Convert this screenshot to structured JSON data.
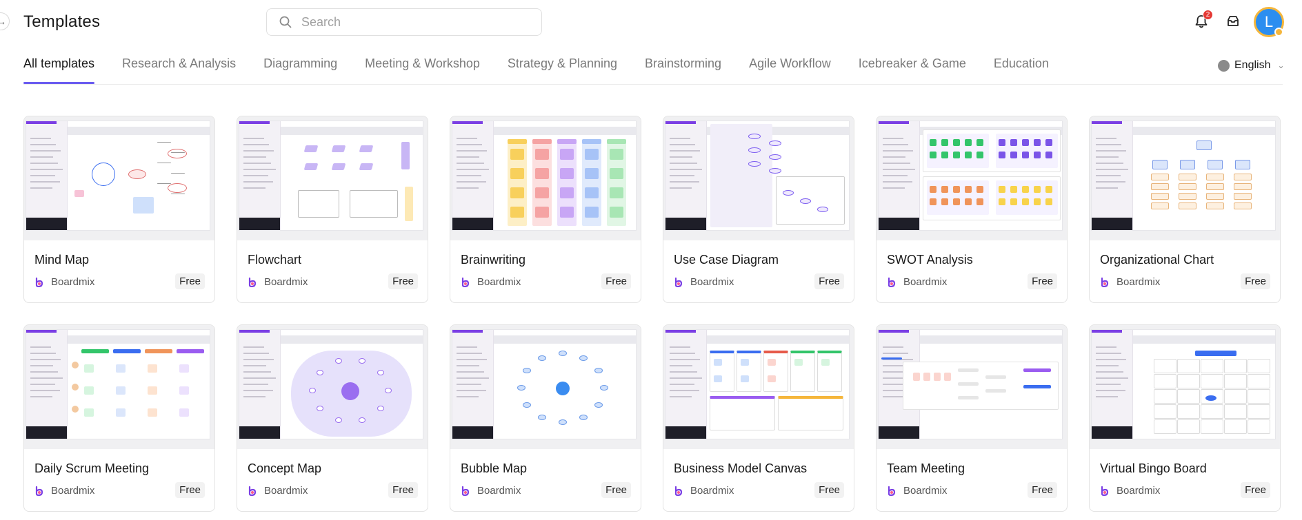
{
  "header": {
    "title": "Templates",
    "search_placeholder": "Search",
    "notification_count": "2",
    "avatar_initial": "L"
  },
  "tabs": [
    {
      "label": "All templates",
      "active": true
    },
    {
      "label": "Research & Analysis"
    },
    {
      "label": "Diagramming"
    },
    {
      "label": "Meeting & Workshop"
    },
    {
      "label": "Strategy & Planning"
    },
    {
      "label": "Brainstorming"
    },
    {
      "label": "Agile Workflow"
    },
    {
      "label": "Icebreaker & Game"
    },
    {
      "label": "Education"
    }
  ],
  "language": "English",
  "colors": {
    "accent": "#6b5cf0",
    "badge": "#e53935",
    "avatar": "#2c8ef0",
    "avatar_ring": "#f5b63b"
  },
  "templates": [
    {
      "name": "Mind Map",
      "brand": "Boardmix",
      "price": "Free"
    },
    {
      "name": "Flowchart",
      "brand": "Boardmix",
      "price": "Free"
    },
    {
      "name": "Brainwriting",
      "brand": "Boardmix",
      "price": "Free"
    },
    {
      "name": "Use Case Diagram",
      "brand": "Boardmix",
      "price": "Free"
    },
    {
      "name": "SWOT Analysis",
      "brand": "Boardmix",
      "price": "Free"
    },
    {
      "name": "Organizational Chart",
      "brand": "Boardmix",
      "price": "Free"
    },
    {
      "name": "Daily Scrum Meeting",
      "brand": "Boardmix",
      "price": "Free"
    },
    {
      "name": "Concept Map",
      "brand": "Boardmix",
      "price": "Free"
    },
    {
      "name": "Bubble Map",
      "brand": "Boardmix",
      "price": "Free"
    },
    {
      "name": "Business Model Canvas",
      "brand": "Boardmix",
      "price": "Free"
    },
    {
      "name": "Team Meeting",
      "brand": "Boardmix",
      "price": "Free"
    },
    {
      "name": "Virtual Bingo Board",
      "brand": "Boardmix",
      "price": "Free"
    }
  ]
}
